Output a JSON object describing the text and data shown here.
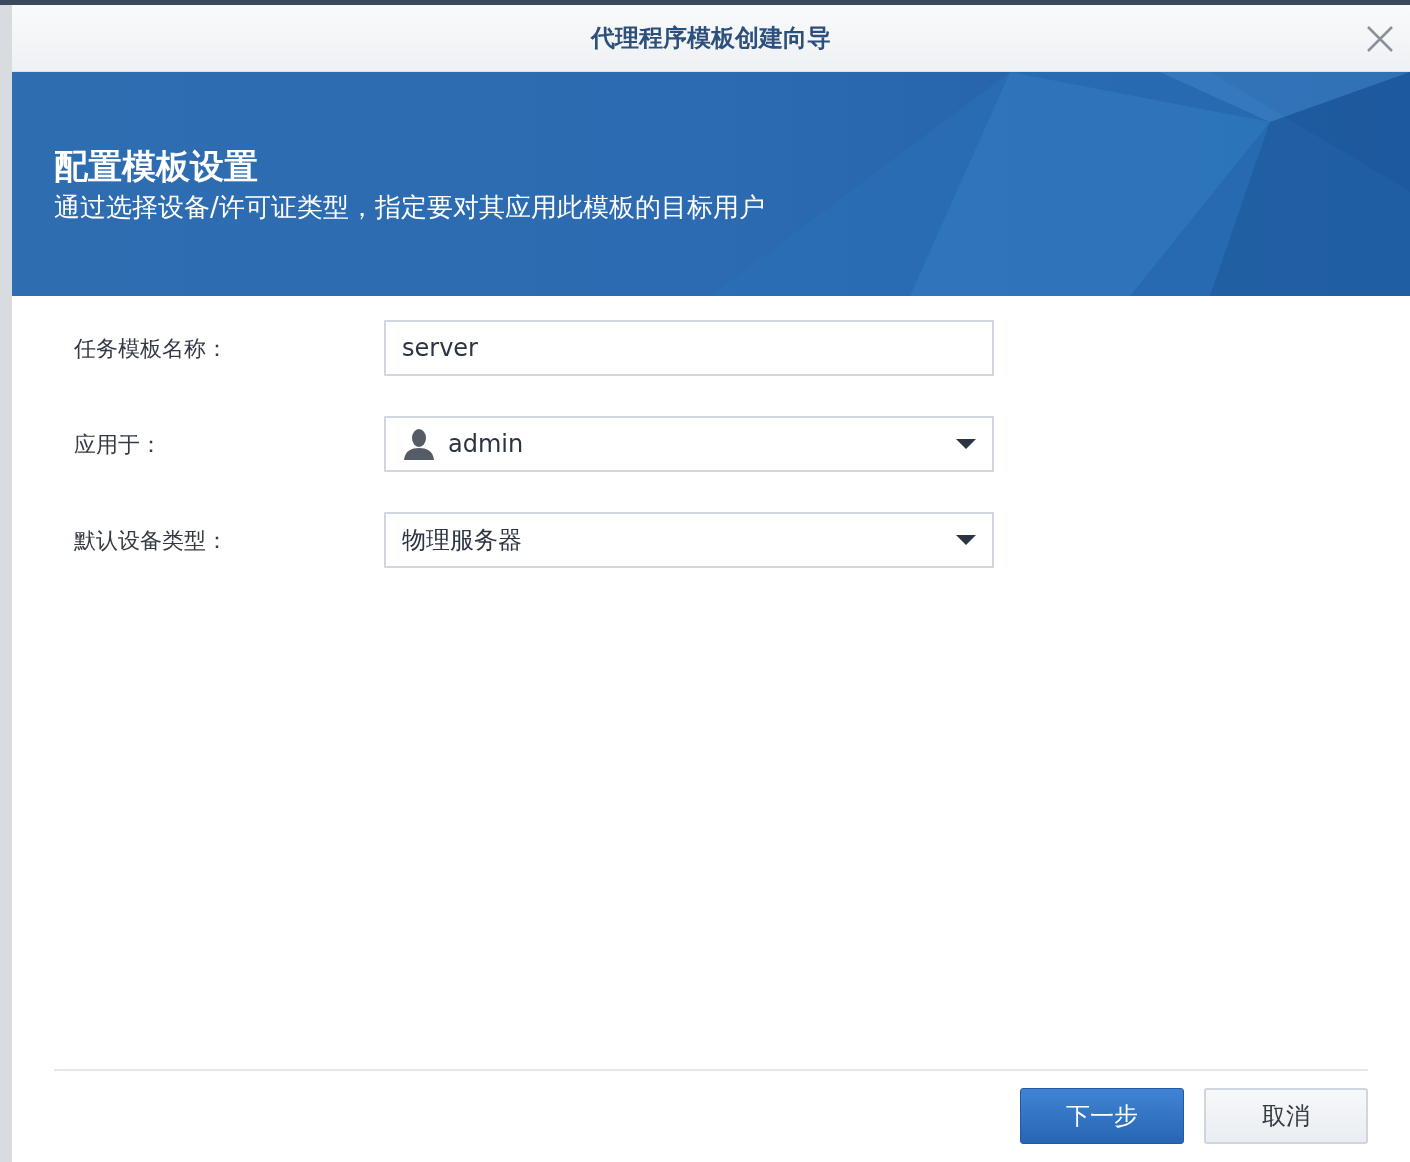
{
  "window": {
    "title": "代理程序模板创建向导"
  },
  "banner": {
    "title": "配置模板设置",
    "subtitle": "通过选择设备/许可证类型，指定要对其应用此模板的目标用户"
  },
  "fields": [
    {
      "kind": "text",
      "label": "任务模板名称：",
      "value": "server"
    },
    {
      "kind": "user-select",
      "label": "应用于：",
      "value": "admin"
    },
    {
      "kind": "select",
      "label": "默认设备类型：",
      "value": "物理服务器"
    }
  ],
  "buttons": [
    {
      "kind": "primary",
      "label": "下一步"
    },
    {
      "kind": "secondary",
      "label": "取消"
    }
  ]
}
